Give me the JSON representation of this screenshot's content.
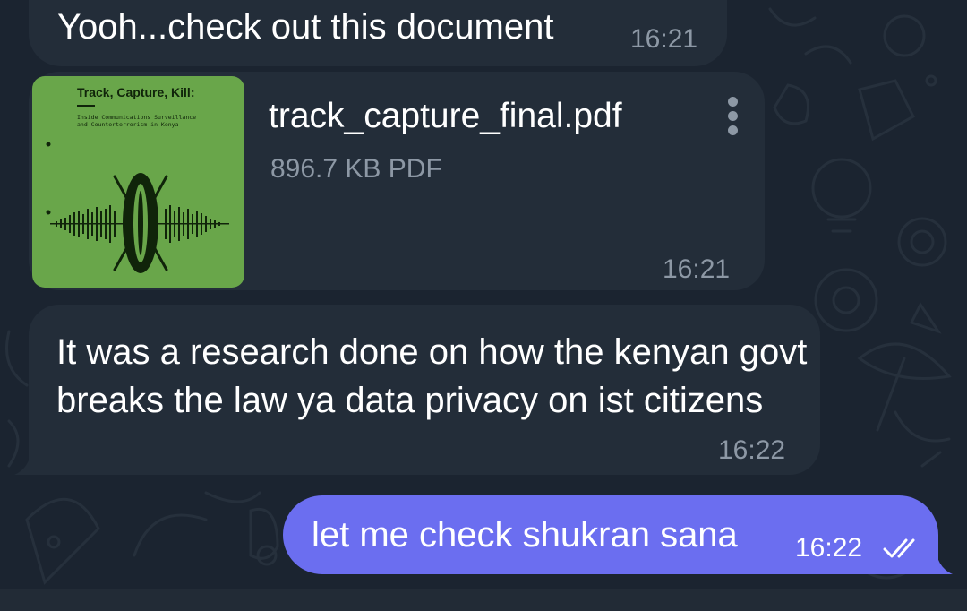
{
  "chat": {
    "messages": [
      {
        "type": "text",
        "direction": "incoming",
        "text": "Yooh...check out this document",
        "time": "16:21"
      },
      {
        "type": "document",
        "direction": "incoming",
        "file_name": "track_capture_final.pdf",
        "file_meta": "896.7 KB PDF",
        "time": "16:21",
        "thumbnail": {
          "title": "Track, Capture, Kill:",
          "subtitle": "Inside Communications Surveillance\nand Counterterrorism in Kenya",
          "background": "#69a64a"
        },
        "menu_icon": "kebab-menu-icon"
      },
      {
        "type": "text",
        "direction": "incoming",
        "text": "It was a research done on how the kenyan govt breaks the law ya data privacy on ist citizens",
        "time": "16:22"
      },
      {
        "type": "text",
        "direction": "outgoing",
        "text": "let me check shukran sana",
        "time": "16:22",
        "status_icon": "double-check-icon"
      }
    ]
  },
  "colors": {
    "background": "#1b2430",
    "incoming_bubble": "#232d39",
    "outgoing_bubble": "#6b6ef0",
    "muted_text": "#8d98a5"
  }
}
